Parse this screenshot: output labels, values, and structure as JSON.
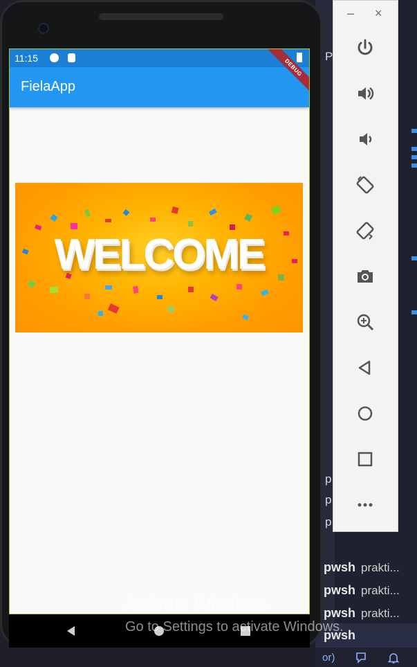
{
  "ide": {
    "p_letter": "P",
    "terminal_rows": [
      {
        "name": "pwsh",
        "detail": "prakti..."
      },
      {
        "name": "pwsh",
        "detail": "prakti..."
      },
      {
        "name": "pwsh",
        "detail": "prakti..."
      },
      {
        "name": "pwsh",
        "detail": ""
      }
    ],
    "partial_rows": [
      "p",
      "p",
      "p"
    ],
    "status_partial": "or)",
    "accent": "#3a8ee6"
  },
  "emulator_toolbar": {
    "minimize_label": "–",
    "close_label": "×",
    "buttons": [
      "power-icon",
      "volume-up-icon",
      "volume-down-icon",
      "rotate-left-icon",
      "rotate-right-icon",
      "camera-icon",
      "zoom-icon",
      "back-icon",
      "home-icon",
      "overview-icon",
      "more-icon"
    ]
  },
  "phone": {
    "status_bar": {
      "time": "11:15"
    },
    "app_bar": {
      "title": "FielaApp",
      "color": "#2196f3"
    },
    "debug_banner": "DEBUG",
    "image": {
      "text": "WELCOME"
    }
  },
  "watermark": {
    "line1": "Activate Windows",
    "line2": "Go to Settings to activate Windows."
  }
}
